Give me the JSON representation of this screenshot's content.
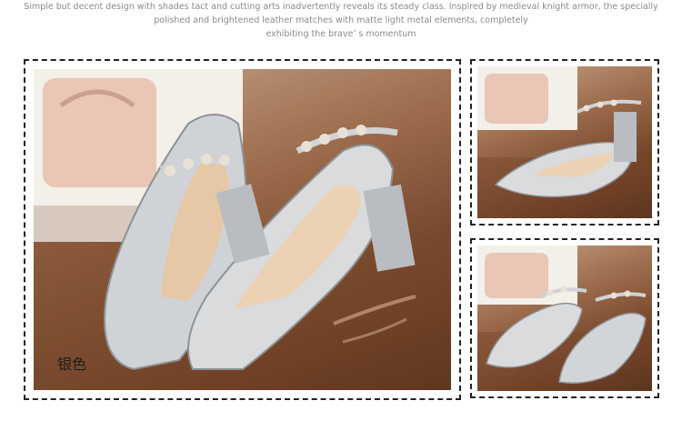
{
  "description": {
    "line1": "Simple but decent design with shades tact and cutting arts inadvertently reveals its steady class. Inspired by medieval knight armor, the specially",
    "line2": "polished and brightened leather matches with matte light metal elements, completely",
    "line3": "exhibiting the brave’ s momentum"
  },
  "main_photo": {
    "caption": "银色",
    "subject": "silver-mary-jane-shoes"
  },
  "side_photos": [
    {
      "subject": "silver-shoes-side-view"
    },
    {
      "subject": "silver-shoes-top-view"
    }
  ],
  "colors": {
    "background": "#ffffff",
    "text_gray": "#8a8a8a",
    "frame_border": "#222222",
    "leather_silver": "#d9dbdd"
  }
}
